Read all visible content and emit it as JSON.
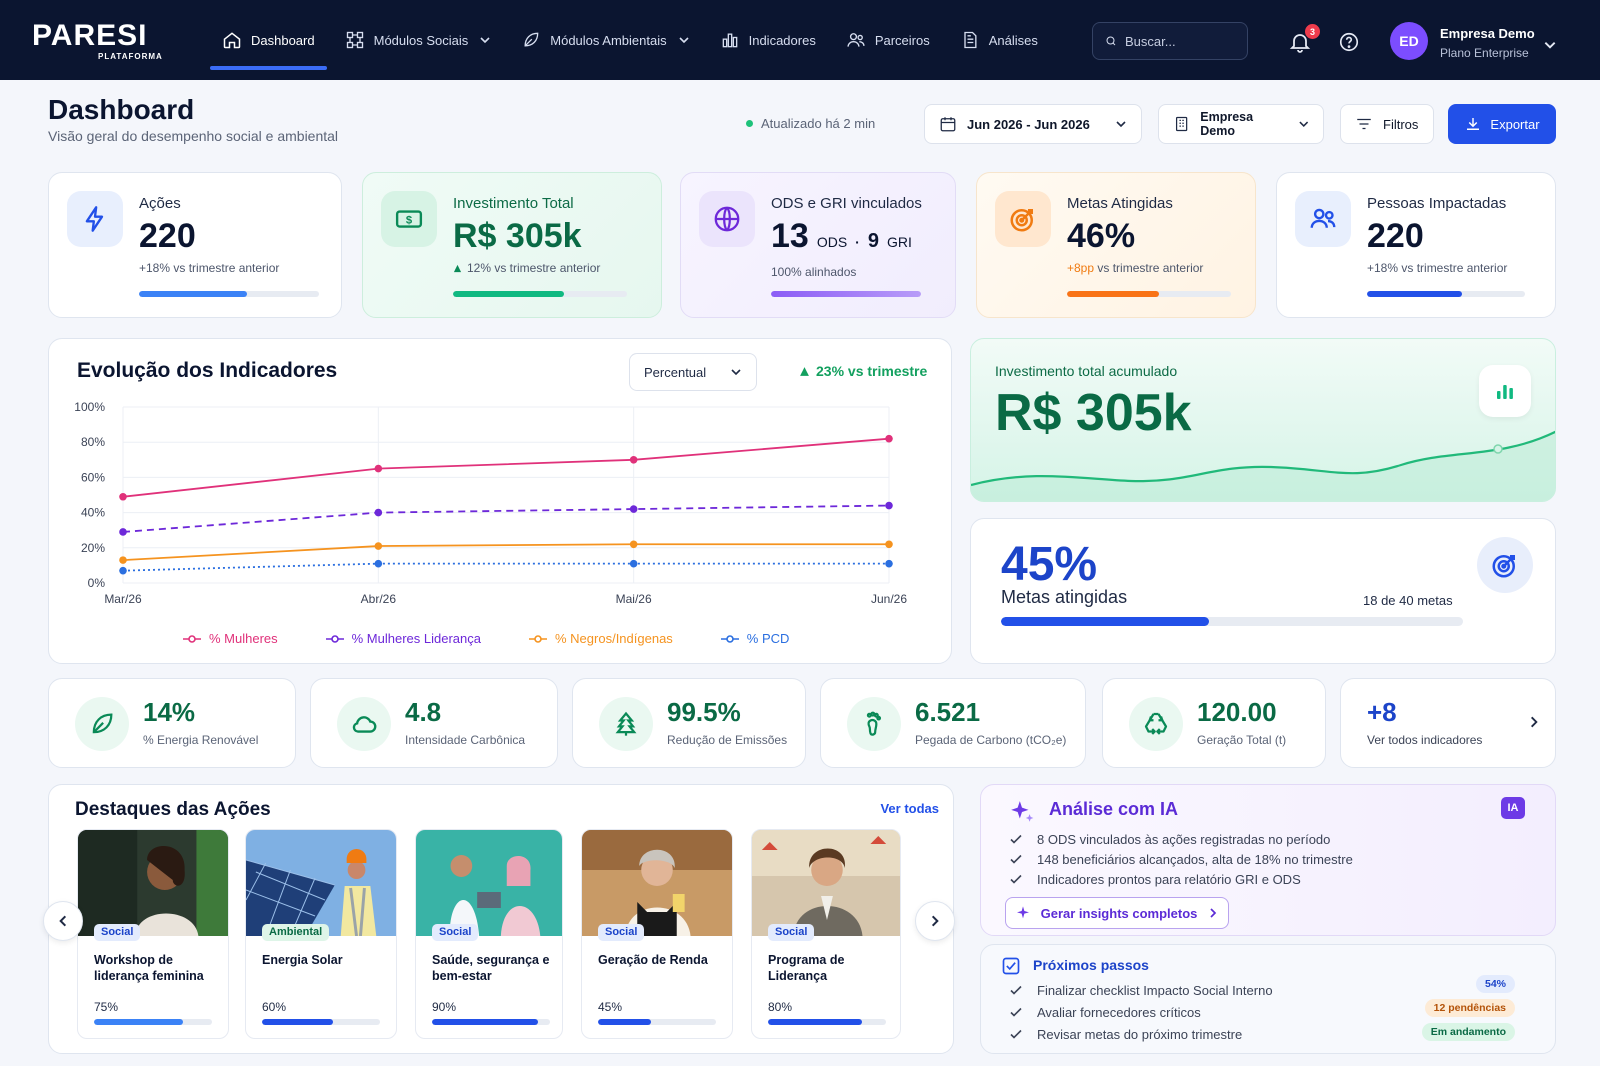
{
  "brand": {
    "name": "PARESI",
    "sub": "PLATAFORMA"
  },
  "nav": [
    {
      "label": "Dashboard",
      "icon": "home-icon",
      "active": true
    },
    {
      "label": "Módulos Sociais",
      "icon": "grid-icon",
      "dropdown": true
    },
    {
      "label": "Módulos Ambientais",
      "icon": "leaf-icon",
      "dropdown": true
    },
    {
      "label": "Indicadores",
      "icon": "bar-chart-icon"
    },
    {
      "label": "Parceiros",
      "icon": "users-icon"
    },
    {
      "label": "Análises",
      "icon": "document-icon"
    }
  ],
  "search": {
    "placeholder": "Buscar..."
  },
  "notifications": {
    "count": "3"
  },
  "user": {
    "initials": "ED",
    "name": "Empresa Demo",
    "plan": "Plano Enterprise"
  },
  "header": {
    "title": "Dashboard",
    "subtitle": "Visão geral do desempenho social e ambiental",
    "updated": "Atualizado há 2 min",
    "date_range": "Jun 2026 - Jun 2026",
    "company": "Empresa Demo",
    "filters": "Filtros",
    "export": "Exportar"
  },
  "kpis": [
    {
      "label": "Ações",
      "value": "220",
      "change": "+18% vs trimestre anterior",
      "progress": 0.6,
      "color": "#3b82f6",
      "icon": "lightning-icon"
    },
    {
      "label": "Investimento Total",
      "value": "R$ 305k",
      "change": "12% vs trimestre anterior",
      "progress": 0.64,
      "color": "#10b981",
      "icon": "money-icon"
    },
    {
      "label": "ODS e GRI vinculados",
      "value": "13",
      "ods_label": "ODS",
      "gri_value": "9",
      "gri_label": "GRI",
      "change": "100% alinhados",
      "progress": 1.0,
      "color": "#8b5cf6",
      "icon": "globe-icon"
    },
    {
      "label": "Metas Atingidas",
      "value": "46%",
      "change_highlight": "+8pp",
      "change": "vs trimestre anterior",
      "progress": 0.56,
      "color": "#f97316",
      "icon": "target-icon"
    },
    {
      "label": "Pessoas Impactadas",
      "value": "220",
      "change": "+18% vs trimestre anterior",
      "progress": 0.6,
      "color": "#2250e8",
      "icon": "people-icon"
    }
  ],
  "evolution": {
    "title": "Evolução dos Indicadores",
    "select_value": "Percentual",
    "trend": "23% vs trimestre"
  },
  "chart_data": {
    "type": "line",
    "x": [
      "Mar/26",
      "Abr/26",
      "Mai/26",
      "Jun/26"
    ],
    "ylim": [
      0,
      100
    ],
    "y_ticks": [
      "0%",
      "20%",
      "40%",
      "60%",
      "80%",
      "100%"
    ],
    "y_tick_values": [
      0,
      20,
      40,
      60,
      80,
      100
    ],
    "grid": true,
    "legend": "bottom",
    "series": [
      {
        "name": "% Mulheres",
        "values": [
          49,
          65,
          70,
          82
        ],
        "color": "#e0317a",
        "style": "solid"
      },
      {
        "name": "% Mulheres Liderança",
        "values": [
          29,
          40,
          42,
          44
        ],
        "color": "#6d28d9",
        "style": "dashed"
      },
      {
        "name": "% Negros/Indígenas",
        "values": [
          13,
          21,
          22,
          22
        ],
        "color": "#f5931f",
        "style": "solid"
      },
      {
        "name": "% PCD",
        "values": [
          7,
          11,
          11,
          11
        ],
        "color": "#2b6fe0",
        "style": "dotted"
      }
    ]
  },
  "investment": {
    "label": "Investimento total acumulado",
    "value": "R$ 305k"
  },
  "goals": {
    "value": "45%",
    "label": "Metas atingidas",
    "count": "18 de 40 metas",
    "progress": 0.45
  },
  "env_indicators": [
    {
      "value": "14%",
      "label": "% Energia Renovável",
      "icon": "leaf-icon"
    },
    {
      "value": "4.8",
      "label": "Intensidade Carbônica",
      "icon": "cloud-icon"
    },
    {
      "value": "99.5%",
      "label": "Redução de Emissões",
      "icon": "tree-icon"
    },
    {
      "value": "6.521",
      "label": "Pegada de Carbono (tCO₂e)",
      "icon": "footprint-icon"
    },
    {
      "value": "120.00",
      "label": "Geração Total (t)",
      "icon": "recycle-icon"
    }
  ],
  "env_more": {
    "value": "+8",
    "label": "Ver todos indicadores"
  },
  "highlights": {
    "title": "Destaques das Ações",
    "see_all": "Ver todas",
    "items": [
      {
        "tag": "Social",
        "type": "social",
        "name": "Workshop de liderança feminina",
        "pct": "75%",
        "progress": 0.75,
        "bar_color": "#3b82f6"
      },
      {
        "tag": "Ambiental",
        "type": "amb",
        "name": "Energia Solar",
        "pct": "60%",
        "progress": 0.6,
        "bar_color": "#2250e8"
      },
      {
        "tag": "Social",
        "type": "social",
        "name": "Saúde, segurança e bem-estar",
        "pct": "90%",
        "progress": 0.9,
        "bar_color": "#2250e8"
      },
      {
        "tag": "Social",
        "type": "social",
        "name": "Geração de Renda",
        "pct": "45%",
        "progress": 0.45,
        "bar_color": "#2250e8"
      },
      {
        "tag": "Social",
        "type": "social",
        "name": "Programa de Liderança",
        "pct": "80%",
        "progress": 0.8,
        "bar_color": "#2250e8"
      }
    ]
  },
  "ai": {
    "title": "Análise com IA",
    "badge": "IA",
    "items": [
      "8 ODS vinculados às ações registradas no período",
      "148 beneficiários alcançados, alta de 18% no trimestre",
      "Indicadores prontos para relatório GRI e ODS"
    ],
    "button": "Gerar insights completos"
  },
  "next_steps": {
    "title": "Próximos passos",
    "items": [
      {
        "text": "Finalizar checklist Impacto Social Interno",
        "pill": "54%",
        "pill_bg": "#e3ebfd",
        "pill_fg": "#1c44c9"
      },
      {
        "text": "Avaliar fornecedores críticos",
        "pill": "12 pendências",
        "pill_bg": "#fdebd6",
        "pill_fg": "#b45309"
      },
      {
        "text": "Revisar metas do próximo trimestre",
        "pill": "Em andamento",
        "pill_bg": "#daf5e6",
        "pill_fg": "#0a6a45"
      }
    ]
  }
}
